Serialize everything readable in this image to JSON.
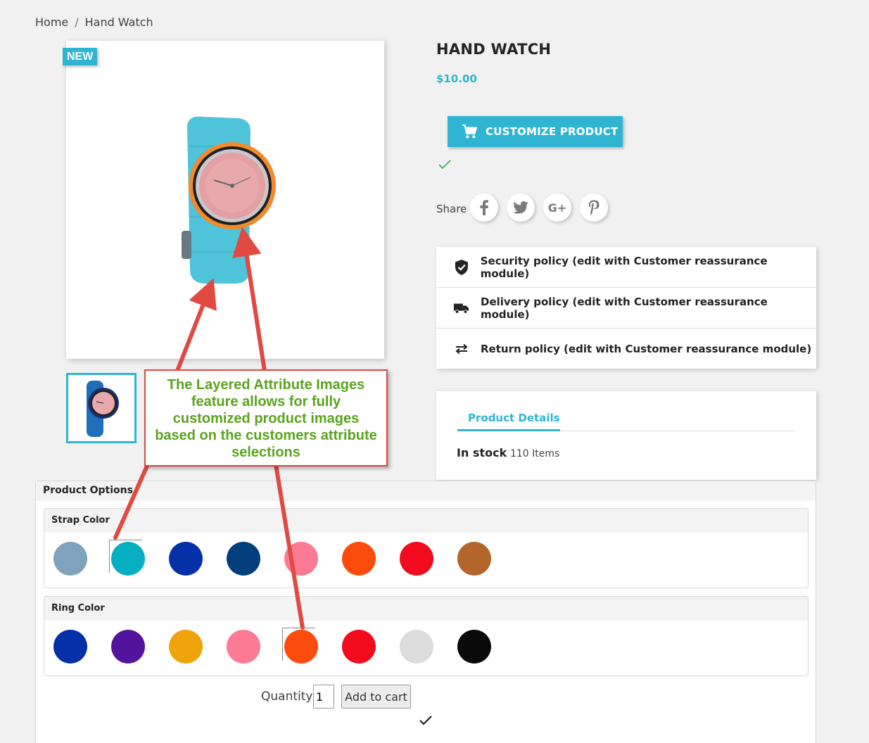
{
  "breadcrumb": {
    "home": "Home",
    "separator": "/",
    "current": "Hand Watch"
  },
  "product": {
    "badge": "NEW",
    "title": "HAND WATCH",
    "price": "$10.00",
    "customize_label": "CUSTOMIZE PRODUCT",
    "share_label": "Share",
    "social": [
      {
        "icon": "facebook-icon",
        "glyph": "f"
      },
      {
        "icon": "twitter-icon",
        "glyph": "t"
      },
      {
        "icon": "google-plus-icon",
        "glyph": "G+"
      },
      {
        "icon": "pinterest-icon",
        "glyph": "p"
      }
    ]
  },
  "reassurance": [
    {
      "icon": "shield-check-icon",
      "text": "Security policy (edit with Customer reassurance module)"
    },
    {
      "icon": "truck-icon",
      "text": "Delivery policy (edit with Customer reassurance module)"
    },
    {
      "icon": "swap-arrows-icon",
      "text": "Return policy (edit with Customer reassurance module)"
    }
  ],
  "details": {
    "tab": "Product Details",
    "stock_label": "In stock",
    "stock_qty": "110 Items"
  },
  "callout": {
    "text": "The Layered Attribute Images feature allows for fully customized product images based on the customers attribute selections"
  },
  "options": {
    "title": "Product Options",
    "strap": {
      "label": "Strap Color",
      "colors": [
        "#7fa3bd",
        "#07afc2",
        "#0530a8",
        "#033f7d",
        "#fd7a94",
        "#fb4c0e",
        "#f20a1e",
        "#b3652c"
      ],
      "selected_index": 1
    },
    "ring": {
      "label": "Ring Color",
      "colors": [
        "#0530a8",
        "#53139b",
        "#eea40a",
        "#fd7a94",
        "#fb4c0e",
        "#f20a1e",
        "#dcdcdc",
        "#0a0a0a"
      ],
      "selected_index": 4
    },
    "quantity_label": "Quantity:",
    "quantity_value": "1",
    "add_to_cart": "Add to cart"
  },
  "colors": {
    "accent": "#2fb5d2",
    "callout_border": "#e04a41",
    "callout_text": "#5aa31e"
  }
}
